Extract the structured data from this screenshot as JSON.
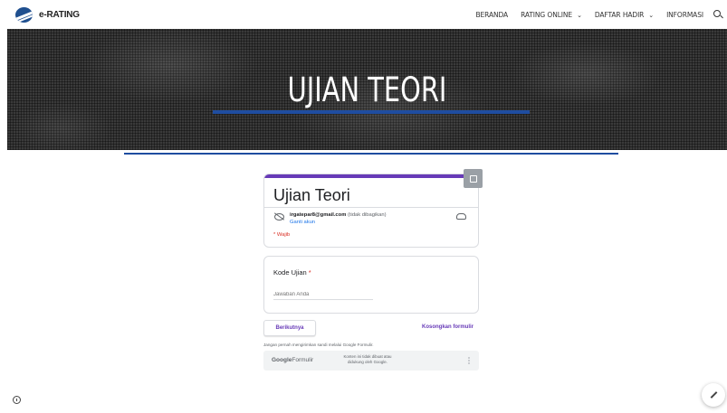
{
  "nav": {
    "brand": "e-RATING",
    "items": [
      {
        "label": "BERANDA",
        "dropdown": false
      },
      {
        "label": "RATING ONLINE",
        "dropdown": true
      },
      {
        "label": "DAFTAR HADIR",
        "dropdown": true
      },
      {
        "label": "INFORMASI",
        "dropdown": false
      }
    ],
    "search_icon": "search-icon"
  },
  "hero": {
    "title": "UJIAN TEORI",
    "accent_color": "#1f4da0"
  },
  "form": {
    "title": "Ujian Teori",
    "accent_color": "#673ab7",
    "account_email": "irgatepar8@gmail.com",
    "not_shared": "(tidak dibagikan)",
    "switch_account": "Ganti akun",
    "required_note": "* Wajib",
    "question": {
      "label": "Kode Ujian",
      "required_mark": "*",
      "placeholder": "Jawaban Anda"
    },
    "next_label": "Berikutnya",
    "clear_label": "Kosongkan formulir",
    "password_warning": "Jangan pernah mengirimkan sandi melalui Google Formulir.",
    "footer": {
      "logo_google": "Google",
      "logo_forms": "Formulir",
      "disclaimer": "Konten ini tidak dibuat atau didukung oleh Google."
    }
  },
  "icons": {
    "info": "info-icon",
    "edit": "edit-icon",
    "settings": "settings-icon",
    "cloud": "cloud-icon",
    "visibility_off": "eye-off-icon"
  }
}
